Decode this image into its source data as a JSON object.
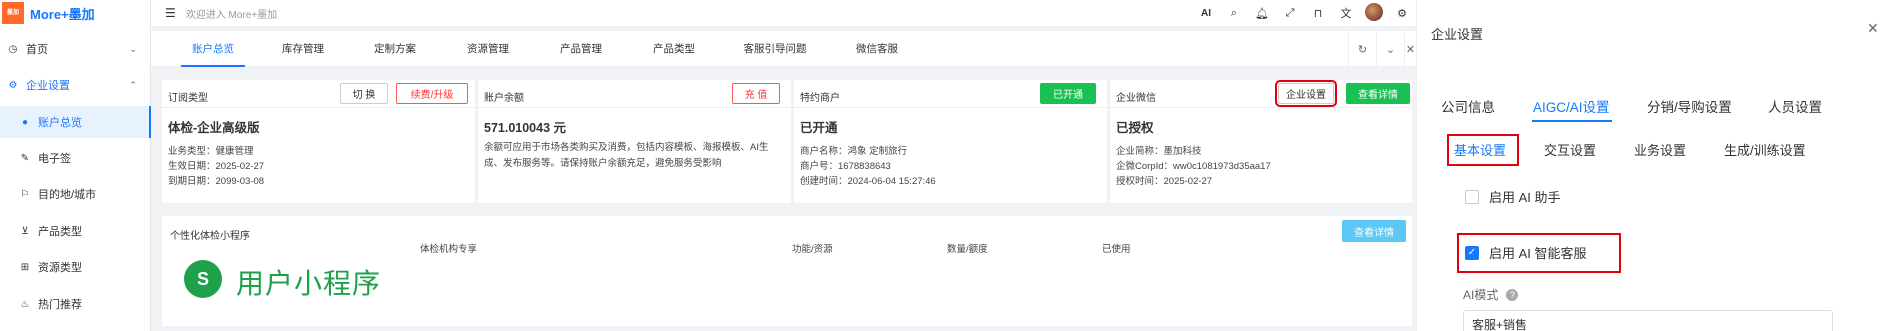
{
  "app": {
    "logo_badge": "墨加",
    "name": "More+墨加"
  },
  "topbar": {
    "welcome": "欢迎进入 More+墨加",
    "icons": [
      "ai-icon",
      "search-icon",
      "bell-icon",
      "fullscreen-icon",
      "lock-icon",
      "translate-icon",
      "avatar",
      "gear-icon"
    ],
    "ai_label": "AI"
  },
  "sidebar": {
    "items": [
      {
        "label": "首页",
        "icon": "clock-icon"
      },
      {
        "label": "企业设置",
        "icon": "gear-icon"
      },
      {
        "label": "账户总览",
        "icon": "dot-icon"
      },
      {
        "label": "电子签",
        "icon": "pen-icon"
      },
      {
        "label": "目的地/城市",
        "icon": "flag-icon"
      },
      {
        "label": "产品类型",
        "icon": "cart-icon"
      },
      {
        "label": "资源类型",
        "icon": "grid-icon"
      },
      {
        "label": "热门推荐",
        "icon": "fire-icon"
      }
    ]
  },
  "tabs": [
    "账户总览",
    "库存管理",
    "定制方案",
    "资源管理",
    "产品管理",
    "产品类型",
    "客服引导问题",
    "微信客服"
  ],
  "cards": {
    "order_type": {
      "title": "订阅类型",
      "btn_switch": "切 换",
      "btn_renew": "续费/升级",
      "value": "体检-企业高级版",
      "lines": [
        "业务类型：健康管理",
        "生效日期：2025-02-27",
        "到期日期：2099-03-08"
      ]
    },
    "balance": {
      "title": "账户余额",
      "btn_recharge": "充 值",
      "value": "571.010043 元",
      "desc": "余额可应用于市场各类购买及消费，包括内容模板、海报模板、AI生成、发布服务等。请保持账户余额充足，避免服务受影响"
    },
    "merchant": {
      "title": "特约商户",
      "btn_open": "已开通",
      "value": "已开通",
      "lines": [
        "商户名称：鸿象 定制旅行",
        "商户号：1678838643",
        "创建时间：2024-06-04 15:27:46"
      ]
    },
    "wecom": {
      "title": "企业微信",
      "btn_settings": "企业设置",
      "btn_details": "查看详情",
      "value": "已授权",
      "lines": [
        "企业简称：墨加科技",
        "企微CorpId：ww0c1081973d35aa17",
        "授权时间：2025-02-27"
      ]
    },
    "mini": {
      "title": "个性化体检小程序",
      "btn_details": "查看详情",
      "logo_text": "用户小程序",
      "columns": [
        "体检机构专享",
        "功能/资源",
        "数量/额度",
        "已使用"
      ]
    }
  },
  "panel": {
    "title": "企业设置",
    "tabs": [
      "公司信息",
      "AIGC/AI设置",
      "分销/导购设置",
      "人员设置"
    ],
    "subtabs": [
      "基本设置",
      "交互设置",
      "业务设置",
      "生成/训练设置"
    ],
    "options": [
      {
        "label": "启用 AI 助手",
        "checked": false
      },
      {
        "label": "启用 AI 智能客服",
        "checked": true
      }
    ],
    "ai_mode_label": "AI模式",
    "ai_mode_value": "客服+销售"
  },
  "colors": {
    "primary": "#1677ff",
    "success": "#18c152",
    "danger": "#e00010",
    "info": "#5bc8f5"
  }
}
